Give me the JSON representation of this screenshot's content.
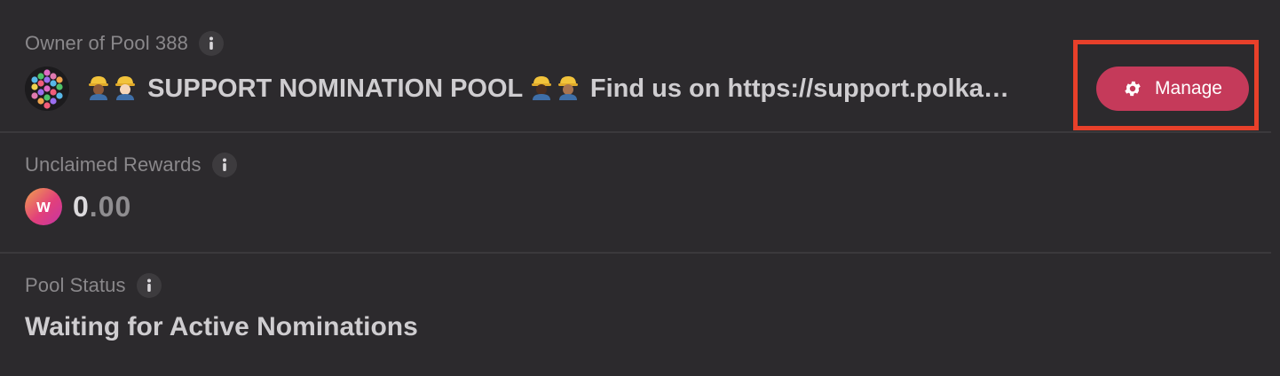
{
  "owner": {
    "label": "Owner of Pool 388",
    "pool_name_prefix": "SUPPORT NOMINATION POOL",
    "pool_name_suffix": "Find us on https://support.polka…",
    "manage_label": "Manage"
  },
  "rewards": {
    "label": "Unclaimed Rewards",
    "token_symbol": "w",
    "value_first": "0",
    "value_rest": ".00"
  },
  "status": {
    "label": "Pool Status",
    "value": "Waiting for Active Nominations"
  },
  "colors": {
    "accent": "#c53a5a",
    "highlight": "#e8402a",
    "background": "#2c2a2d"
  },
  "icons": {
    "info": "info-icon",
    "gear": "gear-icon",
    "identicon": "pool-identicon",
    "token": "token-icon",
    "worker": "construction-worker-emoji"
  }
}
